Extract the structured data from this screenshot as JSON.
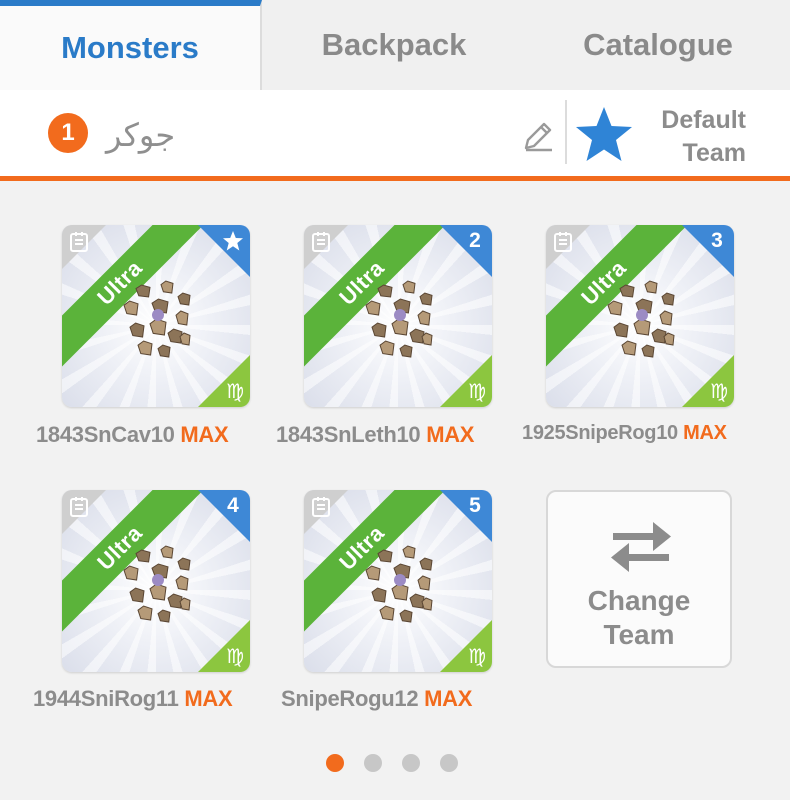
{
  "tabs": [
    {
      "label": "Monsters"
    },
    {
      "label": "Backpack"
    },
    {
      "label": "Catalogue"
    }
  ],
  "team": {
    "number": "1",
    "name": "جوكر",
    "default_line1": "Default",
    "default_line2": "Team"
  },
  "monsters": [
    {
      "rarity": "Ultra",
      "slot": "star",
      "name": "1843SnCav10",
      "level": "MAX"
    },
    {
      "rarity": "Ultra",
      "slot": "2",
      "name": "1843SnLeth10",
      "level": "MAX"
    },
    {
      "rarity": "Ultra",
      "slot": "3",
      "name": "1925SnipeRog10",
      "level": "MAX"
    },
    {
      "rarity": "Ultra",
      "slot": "4",
      "name": "1944SniRog11",
      "level": "MAX"
    },
    {
      "rarity": "Ultra",
      "slot": "5",
      "name": "SnipeRogu12",
      "level": "MAX"
    }
  ],
  "zodiac_glyph": "♍",
  "change_team": {
    "line1": "Change",
    "line2": "Team"
  },
  "pagination": {
    "count": 4,
    "active": 1
  },
  "colors": {
    "accent": "#f26b1d",
    "tab_active": "#2a7bc8",
    "ribbon": "#5bb33a",
    "slot": "#3e88d6",
    "zodiac": "#8cc63f"
  }
}
